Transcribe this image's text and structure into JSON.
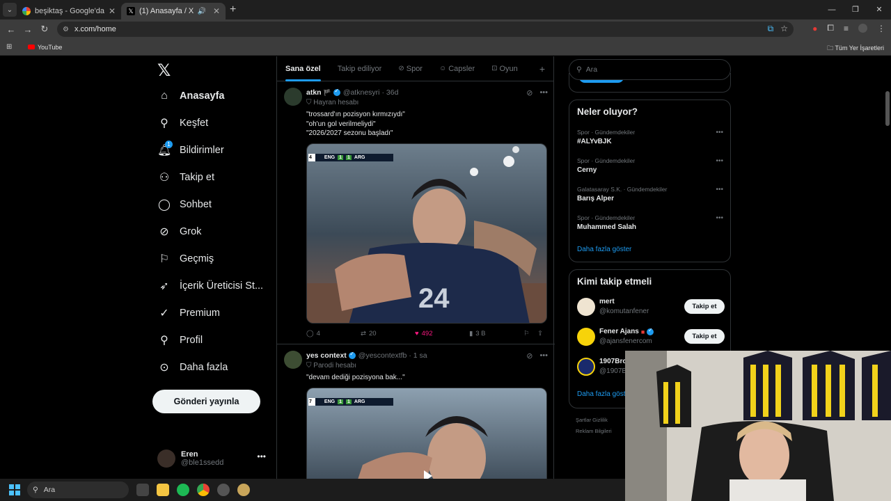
{
  "browser": {
    "tabs": [
      {
        "title": "beşiktaş - Google'da Ara",
        "active": false
      },
      {
        "title": "(1) Anasayfa / X",
        "active": true
      }
    ],
    "url": "x.com/home",
    "bookmark": "YouTube",
    "all_bookmarks": "Tüm Yer İşaretleri"
  },
  "nav": {
    "items": [
      {
        "label": "Anasayfa",
        "icon": "home-icon"
      },
      {
        "label": "Keşfet",
        "icon": "search-icon"
      },
      {
        "label": "Bildirimler",
        "icon": "bell-icon",
        "badge": "1"
      },
      {
        "label": "Takip et",
        "icon": "add-user-icon"
      },
      {
        "label": "Sohbet",
        "icon": "chat-icon"
      },
      {
        "label": "Grok",
        "icon": "grok-icon"
      },
      {
        "label": "Geçmiş",
        "icon": "bookmark-icon"
      },
      {
        "label": "İçerik Üreticisi St...",
        "icon": "rocket-icon"
      },
      {
        "label": "Premium",
        "icon": "verified-icon"
      },
      {
        "label": "Profil",
        "icon": "person-icon"
      },
      {
        "label": "Daha fazla",
        "icon": "more-icon"
      }
    ],
    "post_button": "Gönderi yayınla",
    "account": {
      "name": "Eren",
      "handle": "@ble1ssedd"
    }
  },
  "feed": {
    "tabs": [
      "Sana özel",
      "Takip ediliyor",
      "Spor",
      "Capsler",
      "Oyun"
    ],
    "tweets": [
      {
        "name": "atkn",
        "handle": "@atknesyri",
        "time": "· 36d",
        "label": "Hayran hesabı",
        "text": "\"trossard'ın pozisyon kırmızıydı\"\n\"oh'un gol verilmeliydi\"\n\"2026/2027 sezonu başladı\"",
        "replies": "4",
        "reposts": "20",
        "likes": "492",
        "views": "3 B",
        "score": {
          "t1": "ENG",
          "s1": "1",
          "s2": "1",
          "t2": "ARG",
          "min": "4"
        }
      },
      {
        "name": "yes context",
        "handle": "@yescontextfb",
        "time": "· 1 sa",
        "label": "Parodi hesabı",
        "text": "\"devam dediği pozisyona bak...\"",
        "score": {
          "t1": "ENG",
          "s1": "1",
          "s2": "1",
          "t2": "ARG",
          "min": "7"
        }
      }
    ]
  },
  "right": {
    "search_placeholder": "Ara",
    "trends_title": "Neler oluyor?",
    "trends": [
      {
        "category": "Spor · Gündemdekiler",
        "name": "#ALYvBJK"
      },
      {
        "category": "Spor · Gündemdekiler",
        "name": "Cerny"
      },
      {
        "category": "Galatasaray S.K. · Gündemdekiler",
        "name": "Barış Alper"
      },
      {
        "category": "Spor · Gündemdekiler",
        "name": "Muhammed Salah"
      }
    ],
    "show_more": "Daha fazla göster",
    "who_title": "Kimi takip etmeli",
    "who": [
      {
        "name": "mert",
        "handle": "@komutanfener",
        "button": "Takip et"
      },
      {
        "name": "Fener Ajans",
        "handle": "@ajansfenercom",
        "button": "Takip et"
      },
      {
        "name": "1907Bro",
        "handle": "@1907B"
      }
    ],
    "who_show_more": "Daha fazla göst",
    "footer1": "Şartlar   Gizlilik",
    "footer2": "Reklam Bilgileri"
  },
  "taskbar": {
    "search": "Ara"
  },
  "colors": {
    "accent": "#1d9bf0",
    "like": "#f91880",
    "bg": "#000000"
  }
}
